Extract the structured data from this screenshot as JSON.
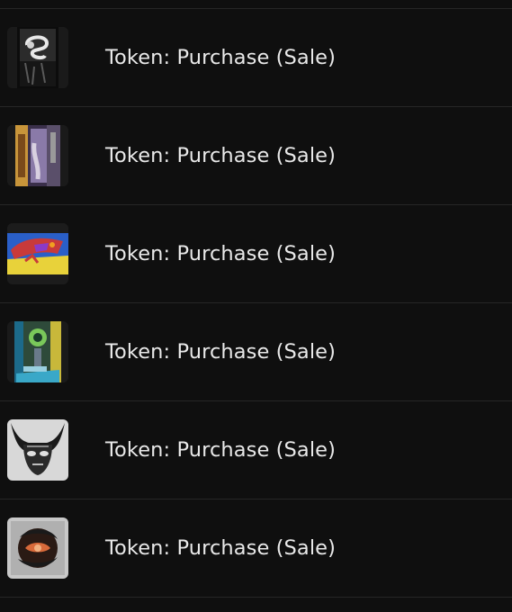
{
  "activity": {
    "items": [
      {
        "label": "Token: Purchase (Sale)",
        "thumbnail": "artwork-thumbnail-1"
      },
      {
        "label": "Token: Purchase (Sale)",
        "thumbnail": "artwork-thumbnail-2"
      },
      {
        "label": "Token: Purchase (Sale)",
        "thumbnail": "artwork-thumbnail-3"
      },
      {
        "label": "Token: Purchase (Sale)",
        "thumbnail": "artwork-thumbnail-4"
      },
      {
        "label": "Token: Purchase (Sale)",
        "thumbnail": "artwork-thumbnail-5"
      },
      {
        "label": "Token: Purchase (Sale)",
        "thumbnail": "artwork-thumbnail-6"
      }
    ]
  },
  "colors": {
    "background": "#0f0f0f",
    "divider": "#262626",
    "text": "#e9e9e9",
    "thumbnail_bg": "#1c1c1c"
  }
}
